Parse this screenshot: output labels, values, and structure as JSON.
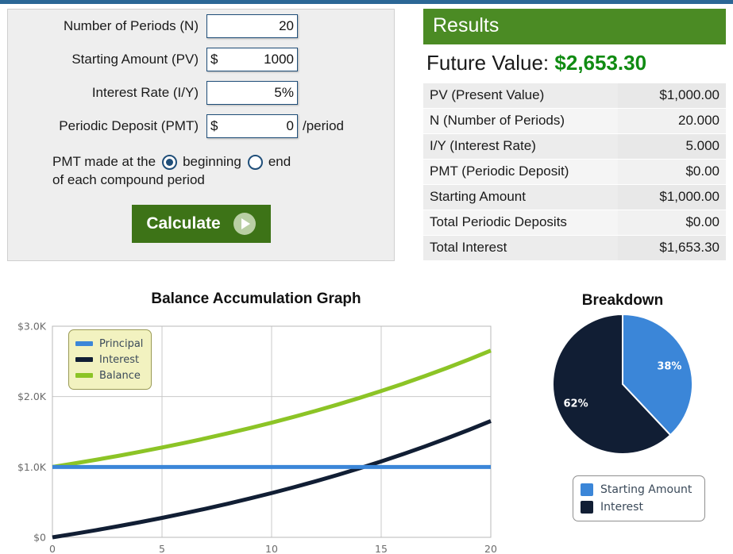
{
  "theme": {
    "top_strip": "#2b6796",
    "header_green": "#4b8b24",
    "button_green": "#3d7317",
    "value_green": "#108b12",
    "input_border": "#1f4e79",
    "principal_blue": "#3b86d8",
    "interest_navy": "#111e34",
    "balance_green": "#8cc426",
    "legend_bg": "#f2f2c0"
  },
  "form": {
    "fields": [
      {
        "label": "Number of Periods (N)",
        "prefix": "",
        "value": "20",
        "suffix": ""
      },
      {
        "label": "Starting Amount (PV)",
        "prefix": "$",
        "value": "1000",
        "suffix": ""
      },
      {
        "label": "Interest Rate (I/Y)",
        "prefix": "",
        "value": "5%",
        "suffix": ""
      },
      {
        "label": "Periodic Deposit (PMT)",
        "prefix": "$",
        "value": "0",
        "suffix": "/period"
      }
    ],
    "pmt_timing": {
      "prefix_text": "PMT made at the",
      "option_beginning": "beginning",
      "option_end": "end",
      "suffix_text": "of each compound period",
      "selected": "beginning"
    },
    "calculate_label": "Calculate"
  },
  "results": {
    "header": "Results",
    "future_value_label": "Future Value:",
    "future_value_amount": "$2,653.30",
    "rows": [
      {
        "label": "PV (Present Value)",
        "value": "$1,000.00"
      },
      {
        "label": "N (Number of Periods)",
        "value": "20.000"
      },
      {
        "label": "I/Y (Interest Rate)",
        "value": "5.000"
      },
      {
        "label": "PMT (Periodic Deposit)",
        "value": "$0.00"
      },
      {
        "label": "Starting Amount",
        "value": "$1,000.00"
      },
      {
        "label": "Total Periodic Deposits",
        "value": "$0.00"
      },
      {
        "label": "Total Interest",
        "value": "$1,653.30"
      }
    ]
  },
  "chart_data": [
    {
      "type": "line",
      "title": "Balance Accumulation Graph",
      "xlabel": "",
      "ylabel": "",
      "xlim": [
        0,
        20
      ],
      "ylim": [
        0,
        3000
      ],
      "grid": true,
      "legend_position": "top-left",
      "xticks": [
        "0",
        "5",
        "10",
        "15",
        "20"
      ],
      "xtick_values": [
        0,
        5,
        10,
        15,
        20
      ],
      "yticks": [
        "$0",
        "$1.0K",
        "$2.0K",
        "$3.0K"
      ],
      "ytick_values": [
        0,
        1000,
        2000,
        3000
      ],
      "x": [
        0,
        1,
        2,
        3,
        4,
        5,
        6,
        7,
        8,
        9,
        10,
        11,
        12,
        13,
        14,
        15,
        16,
        17,
        18,
        19,
        20
      ],
      "series": [
        {
          "name": "Principal",
          "color": "#3b86d8",
          "values": [
            1000,
            1000,
            1000,
            1000,
            1000,
            1000,
            1000,
            1000,
            1000,
            1000,
            1000,
            1000,
            1000,
            1000,
            1000,
            1000,
            1000,
            1000,
            1000,
            1000,
            1000
          ]
        },
        {
          "name": "Interest",
          "color": "#111e34",
          "values": [
            0,
            50,
            102.5,
            157.63,
            215.51,
            276.28,
            340.1,
            407.1,
            477.46,
            551.33,
            628.89,
            710.34,
            795.86,
            885.65,
            979.93,
            1078.93,
            1182.88,
            1292.02,
            1406.62,
            1526.95,
            1653.3
          ]
        },
        {
          "name": "Balance",
          "color": "#8cc426",
          "values": [
            1000,
            1050,
            1102.5,
            1157.63,
            1215.51,
            1276.28,
            1340.1,
            1407.1,
            1477.46,
            1551.33,
            1628.89,
            1710.34,
            1795.86,
            1885.65,
            1979.93,
            2078.93,
            2182.88,
            2292.02,
            2406.62,
            2526.95,
            2653.3
          ]
        }
      ]
    },
    {
      "type": "pie",
      "title": "Breakdown",
      "legend_position": "bottom",
      "labels": [
        "Starting Amount",
        "Interest"
      ],
      "values": [
        38,
        62
      ],
      "display_labels": [
        "38%",
        "62%"
      ],
      "colors": [
        "#3b86d8",
        "#111e34"
      ]
    }
  ]
}
